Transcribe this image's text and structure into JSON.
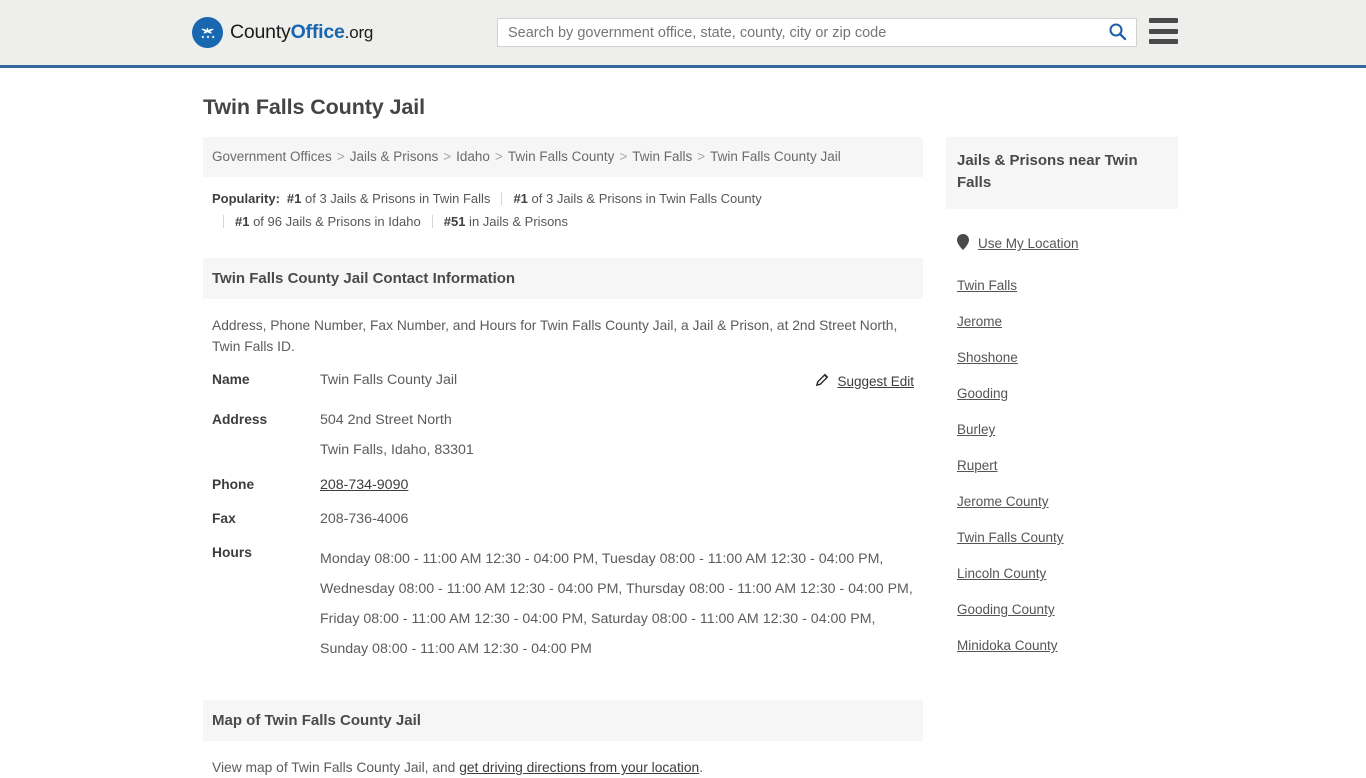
{
  "header": {
    "logo": {
      "part1": "County",
      "part2": "Office",
      "part3": ".org",
      "icon": "eagle-shield-logo"
    },
    "search": {
      "placeholder": "Search by government office, state, county, city or zip code",
      "value": "",
      "search_icon": "search-icon"
    },
    "menu_icon": "hamburger-menu-icon",
    "accent_color": "#36699f",
    "background": "#eeeeec"
  },
  "page_title": "Twin Falls County Jail",
  "breadcrumb": {
    "items": [
      "Government Offices",
      "Jails & Prisons",
      "Idaho",
      "Twin Falls County",
      "Twin Falls",
      "Twin Falls County Jail"
    ],
    "separator": ">"
  },
  "popularity": {
    "label": "Popularity:",
    "items": [
      {
        "rank": "#1",
        "text": " of 3 Jails & Prisons in Twin Falls"
      },
      {
        "rank": "#1",
        "text": " of 3 Jails & Prisons in Twin Falls County"
      },
      {
        "rank": "#1",
        "text": " of 96 Jails & Prisons in Idaho"
      },
      {
        "rank": "#51",
        "text": " in Jails & Prisons"
      }
    ]
  },
  "contact_section": {
    "heading": "Twin Falls County Jail Contact Information",
    "description": "Address, Phone Number, Fax Number, and Hours for Twin Falls County Jail, a Jail & Prison, at 2nd Street North, Twin Falls ID.",
    "suggest_edit": {
      "label": "Suggest Edit",
      "icon": "edit-pencil-icon"
    },
    "rows": [
      {
        "key": "Name",
        "value": "Twin Falls County Jail"
      },
      {
        "key": "Address",
        "value": "504 2nd Street North",
        "value2": "Twin Falls, Idaho, 83301"
      },
      {
        "key": "Phone",
        "value": "208-734-9090",
        "link": true
      },
      {
        "key": "Fax",
        "value": "208-736-4006"
      },
      {
        "key": "Hours",
        "value": "Monday 08:00 - 11:00 AM 12:30 - 04:00 PM, Tuesday 08:00 - 11:00 AM 12:30 - 04:00 PM, Wednesday 08:00 - 11:00 AM 12:30 - 04:00 PM, Thursday 08:00 - 11:00 AM 12:30 - 04:00 PM, Friday 08:00 - 11:00 AM 12:30 - 04:00 PM, Saturday 08:00 - 11:00 AM 12:30 - 04:00 PM, Sunday 08:00 - 11:00 AM 12:30 - 04:00 PM"
      }
    ]
  },
  "map_section": {
    "heading": "Map of Twin Falls County Jail",
    "text_before": "View map of Twin Falls County Jail, and ",
    "link_text": "get driving directions from your location",
    "text_after": "."
  },
  "sidebar": {
    "heading": "Jails & Prisons near Twin Falls",
    "use_my_location": {
      "label": "Use My Location",
      "icon": "map-pin-icon"
    },
    "items": [
      "Twin Falls",
      "Jerome",
      "Shoshone",
      "Gooding",
      "Burley",
      "Rupert",
      "Jerome County",
      "Twin Falls County",
      "Lincoln County",
      "Gooding County",
      "Minidoka County"
    ]
  }
}
